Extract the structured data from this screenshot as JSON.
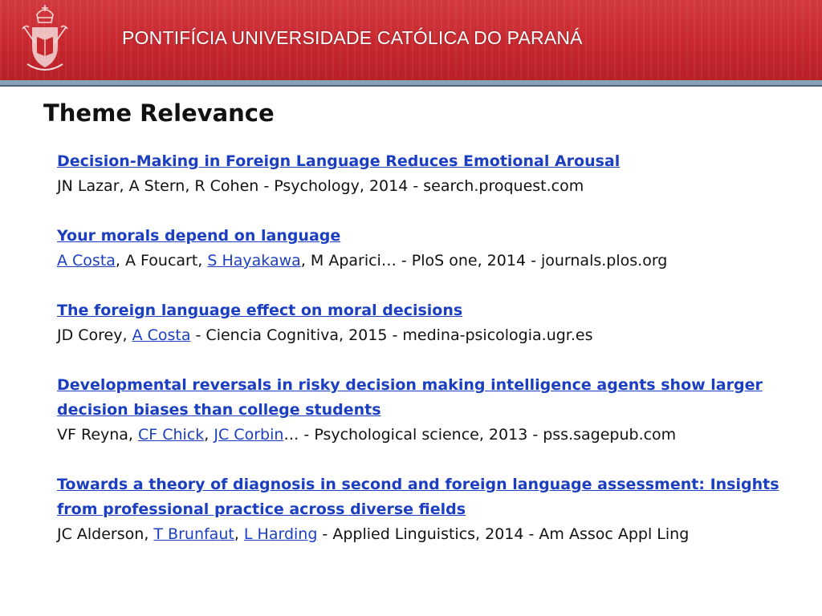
{
  "header": {
    "institution_name": "PONTIFÍCIA UNIVERSIDADE CATÓLICA DO PARANÁ",
    "colors": {
      "banner_red": "#c7282f",
      "rule_blue": "#8aa0b6",
      "link_blue": "#1b3fc0"
    },
    "emblem_icon": "university-crest-icon"
  },
  "page": {
    "title": "Theme Relevance"
  },
  "references": [
    {
      "title_lines": [
        "Decision-Making in Foreign Language Reduces Emotional Arousal"
      ],
      "authors": [
        "JN Lazar, A Stern, R Cohen"
      ],
      "source": " - Psychology, 2014 - search.proquest.com"
    },
    {
      "title_lines": [
        "Your morals depend on language"
      ],
      "authors": [
        "A Costa",
        ", A Foucart, ",
        "S Hayakawa",
        ", M Aparici…"
      ],
      "source": " - PloS one, 2014 - journals.plos.org"
    },
    {
      "title_lines": [
        "The foreign language effect on moral decisions"
      ],
      "authors": [
        "JD Corey, ",
        "A Costa"
      ],
      "source": " - Ciencia Cognitiva, 2015 - medina-psicologia.ugr.es"
    },
    {
      "title_lines": [
        "Developmental reversals in risky decision making intelligence agents show larger",
        "decision biases than college students"
      ],
      "authors": [
        "VF Reyna, ",
        "CF Chick",
        ", ",
        "JC Corbin",
        "…"
      ],
      "source": " - Psychological science, 2013 - pss.sagepub.com"
    },
    {
      "title_lines": [
        "Towards a theory of diagnosis in second and foreign language assessment: Insights",
        "from professional practice across diverse fields"
      ],
      "authors": [
        "JC Alderson, ",
        "T Brunfaut",
        ", ",
        "L Harding"
      ],
      "source": " - Applied Linguistics, 2014 - Am Assoc Appl Ling"
    }
  ]
}
